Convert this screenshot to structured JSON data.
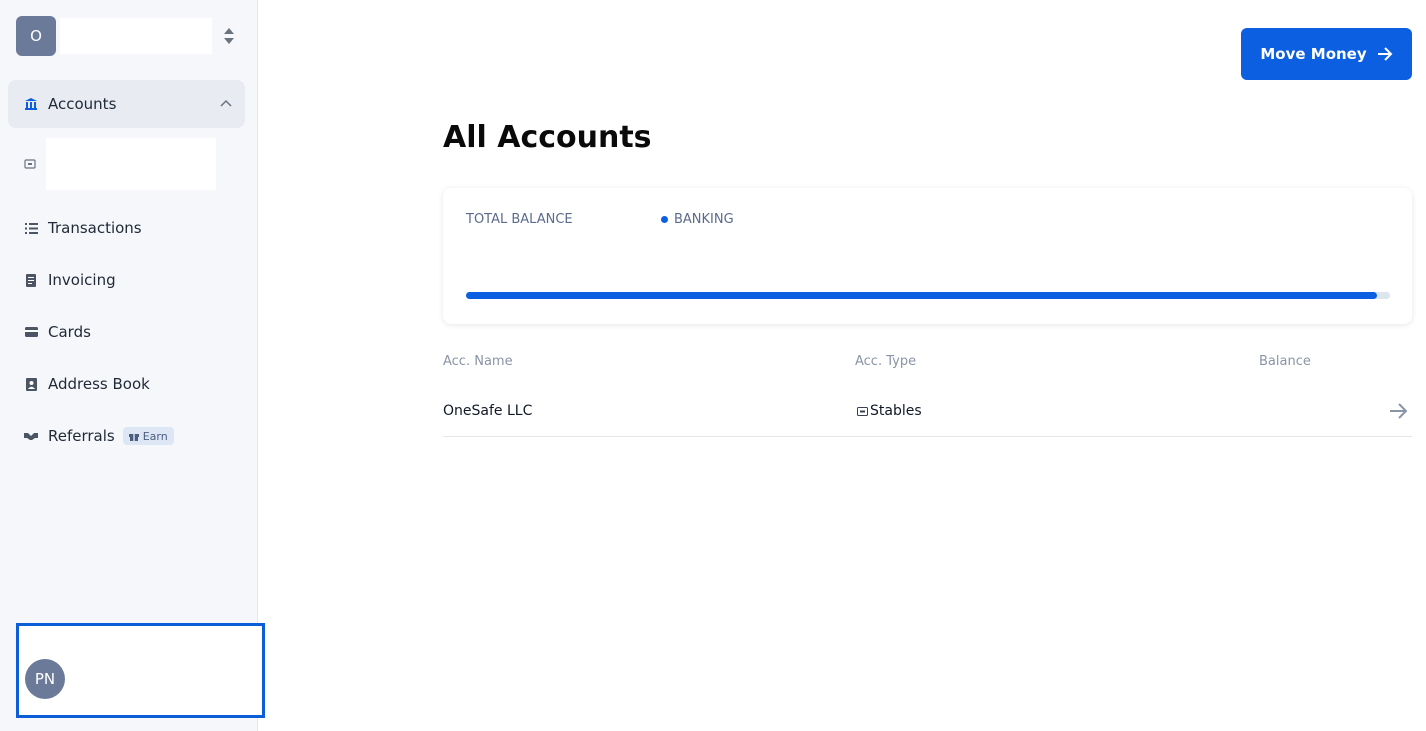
{
  "org": {
    "initial": "O"
  },
  "sidebar": {
    "accounts_label": "Accounts",
    "items": [
      {
        "label": "Transactions",
        "icon": "list-icon"
      },
      {
        "label": "Invoicing",
        "icon": "receipt-icon"
      },
      {
        "label": "Cards",
        "icon": "card-icon"
      },
      {
        "label": "Address Book",
        "icon": "contact-book-icon"
      },
      {
        "label": "Referrals",
        "icon": "handshake-icon",
        "badge": "Earn"
      }
    ]
  },
  "user": {
    "initials": "PN"
  },
  "header": {
    "move_money_label": "Move Money"
  },
  "main": {
    "title": "All Accounts",
    "balance": {
      "label": "TOTAL BALANCE",
      "legend": "BANKING",
      "banking_fraction": 0.986
    },
    "table": {
      "headers": [
        "Acc. Name",
        "Acc. Type",
        "Balance"
      ],
      "rows": [
        {
          "name": "OneSafe LLC",
          "type": "Stables"
        }
      ]
    }
  },
  "colors": {
    "accent": "#0b5fe0",
    "highlight_border": "#0b5ed7"
  }
}
